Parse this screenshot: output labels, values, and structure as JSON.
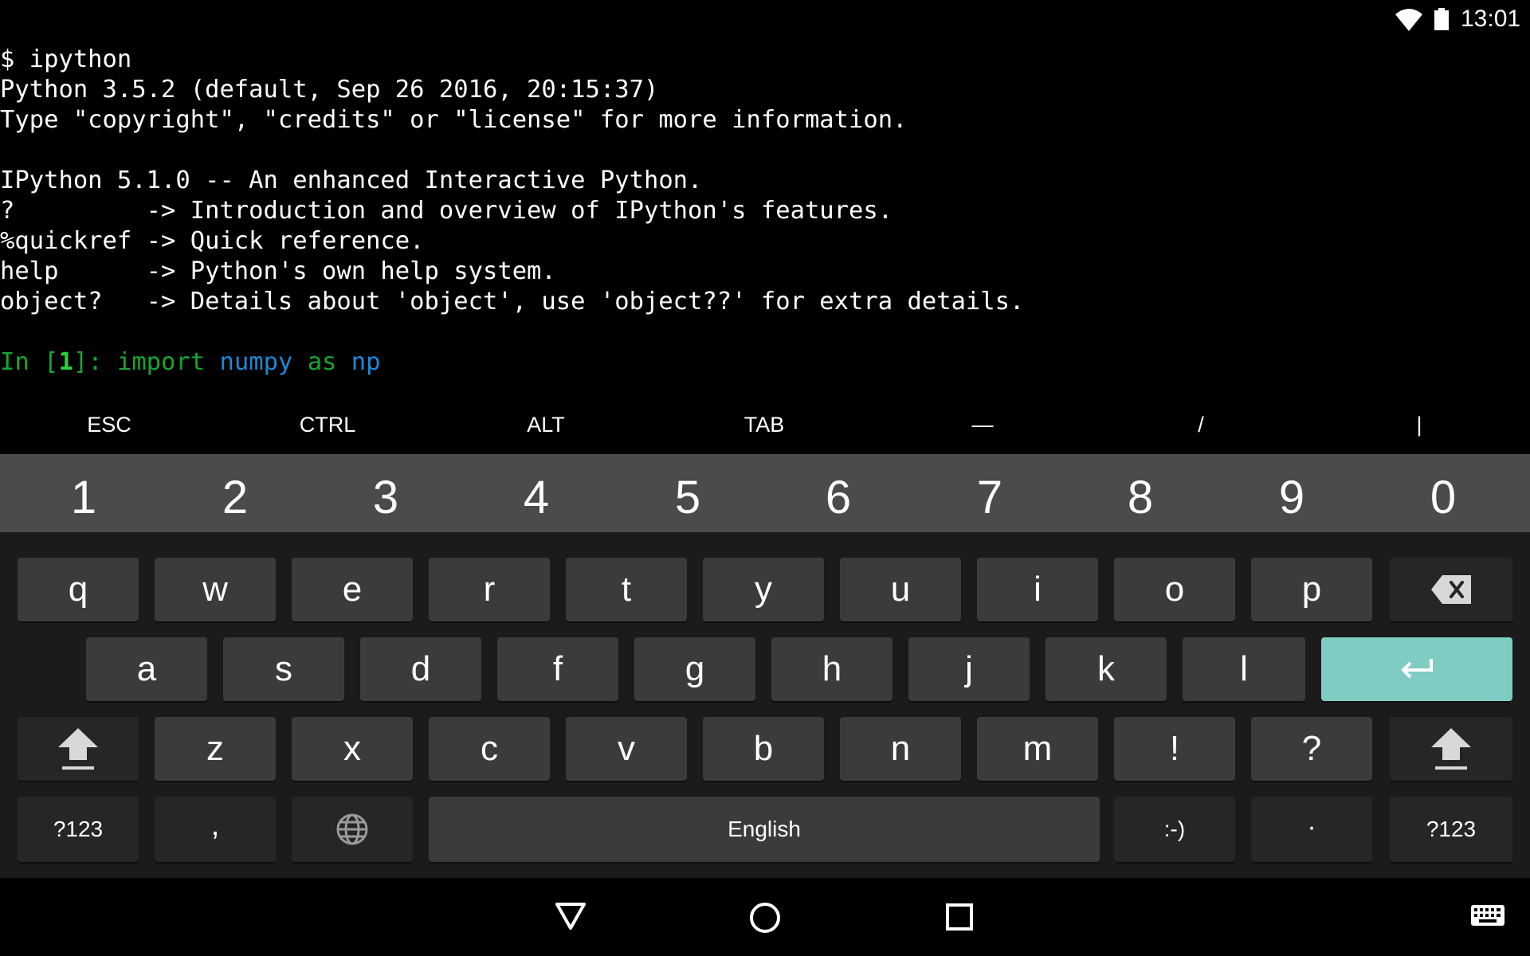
{
  "status_bar": {
    "time": "13:01",
    "icons": [
      "wifi-icon",
      "battery-icon"
    ]
  },
  "terminal": {
    "lines": [
      "$ ipython",
      "Python 3.5.2 (default, Sep 26 2016, 20:15:37)",
      "Type \"copyright\", \"credits\" or \"license\" for more information.",
      "",
      "IPython 5.1.0 -- An enhanced Interactive Python.",
      "?         -> Introduction and overview of IPython's features.",
      "%quickref -> Quick reference.",
      "help      -> Python's own help system.",
      "object?   -> Details about 'object', use 'object??' for extra details.",
      ""
    ],
    "prompt": {
      "prefix": "In [",
      "number": "1",
      "suffix": "]: ",
      "keyword_import": "import",
      "module": "numpy",
      "keyword_as": "as",
      "alias": "np"
    },
    "colors": {
      "prompt": "#16a532",
      "prompt_number": "#29d13a",
      "module": "#1e88d8"
    }
  },
  "extra_keys": [
    "ESC",
    "CTRL",
    "ALT",
    "TAB",
    "—",
    "/",
    "|"
  ],
  "keyboard": {
    "number_row": [
      "1",
      "2",
      "3",
      "4",
      "5",
      "6",
      "7",
      "8",
      "9",
      "0"
    ],
    "row1": [
      "q",
      "w",
      "e",
      "r",
      "t",
      "y",
      "u",
      "i",
      "o",
      "p"
    ],
    "row2": [
      "a",
      "s",
      "d",
      "f",
      "g",
      "h",
      "j",
      "k",
      "l"
    ],
    "row3": [
      "z",
      "x",
      "c",
      "v",
      "b",
      "n",
      "m",
      "!",
      "?"
    ],
    "symbols_left": "?123",
    "comma": ",",
    "space": "English",
    "smiley": ":-)",
    "period": "·",
    "symbols_right": "?123",
    "icons": [
      "backspace-icon",
      "enter-icon",
      "shift-icon",
      "globe-icon"
    ],
    "accent_color": "#7fcdc2"
  },
  "nav_bar": {
    "icons": [
      "back-icon",
      "home-icon",
      "recents-icon",
      "keyboard-icon"
    ]
  }
}
